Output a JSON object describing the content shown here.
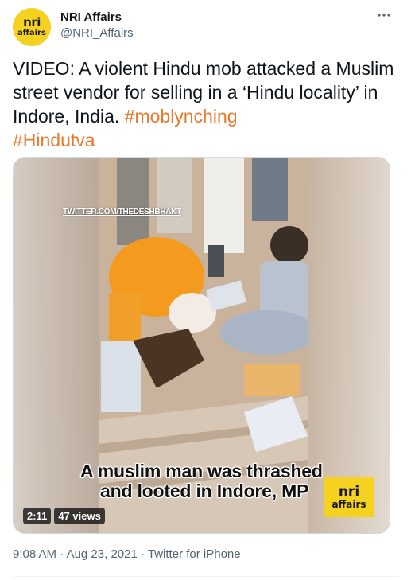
{
  "author": {
    "avatar_line1": "nri",
    "avatar_line2": "affairs",
    "name": "NRI Affairs",
    "handle": "@NRI_Affairs"
  },
  "tweet": {
    "text": "VIDEO: A violent Hindu mob attacked a Muslim street vendor for selling in a ‘Hindu locality’ in Indore, India. ",
    "hashtags": [
      "#moblynching",
      "#Hindutva"
    ],
    "hashtag_color": "#e8792b"
  },
  "media": {
    "watermark": "TWITTER.COM/THEDESHBHAKT",
    "caption_line1": "A muslim man was thrashed",
    "caption_line2": "and looted in Indore, MP",
    "logo_line1": "nri",
    "logo_line2": "affairs",
    "duration": "2:11",
    "views": "47 views"
  },
  "meta": {
    "time": "9:08 AM",
    "date": "Aug 23, 2021",
    "source": "Twitter for iPhone",
    "separator": "·"
  },
  "icons": {
    "more": "more-horizontal-icon"
  }
}
